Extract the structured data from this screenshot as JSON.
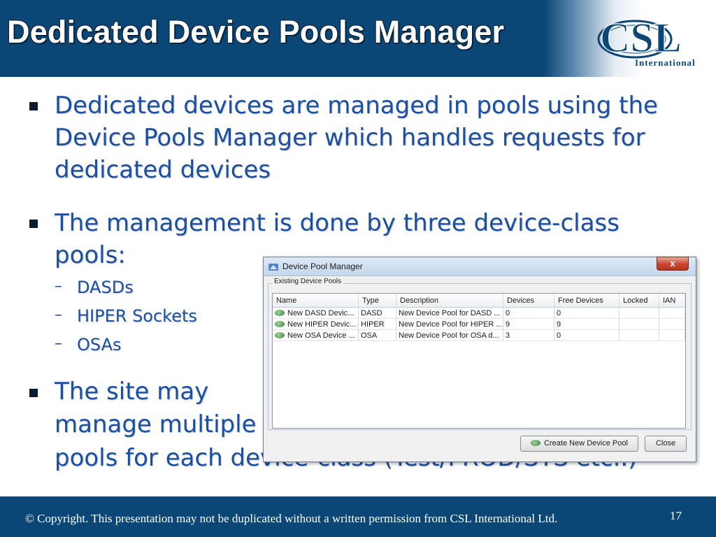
{
  "slide": {
    "title": "Dedicated Device Pools Manager",
    "logo_text": "CSL",
    "logo_subtext": "International",
    "bullets": [
      {
        "lines": [
          "Dedicated devices are managed in pools using the",
          "Device Pools Manager which handles requests for",
          "dedicated devices"
        ]
      },
      {
        "lines": [
          "The management is done by three device-class",
          "pools:"
        ],
        "sub_items": [
          "DASDs",
          "HIPER Sockets",
          "OSAs"
        ]
      },
      {
        "lines": [
          "The site may",
          "manage multiple",
          "pools for each device-class (Test/PROD/SYS etc..)"
        ]
      }
    ],
    "sub_dash": "–"
  },
  "dialog": {
    "title": "Device Pool Manager",
    "close_label": "x",
    "group_label": "Existing Device Pools",
    "columns": [
      "Name",
      "Type",
      "Description",
      "Devices",
      "Free Devices",
      "Locked",
      "IAN"
    ],
    "rows": [
      [
        "New DASD Devic...",
        "DASD",
        "New Device Pool for DASD ...",
        "0",
        "0",
        "",
        ""
      ],
      [
        "New HIPER Devic...",
        "HIPER",
        "New Device Pool for HIPER ...",
        "9",
        "9",
        "",
        ""
      ],
      [
        "New OSA Device ...",
        "OSA",
        "New Device Pool for OSA d...",
        "3",
        "0",
        "",
        ""
      ]
    ],
    "buttons": {
      "create": "Create New Device Pool",
      "close": "Close"
    }
  },
  "footer": {
    "copyright": "© Copyright. This presentation may not be duplicated without a written permission from CSL International Ltd.",
    "page_number": "17"
  },
  "colors": {
    "header_bg": "#0b4776",
    "bullet_text": "#1d4fa0",
    "footer_bg": "#0b4776"
  }
}
